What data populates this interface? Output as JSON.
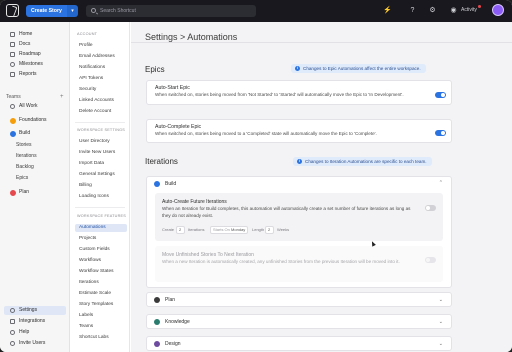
{
  "topbar": {
    "create_label": "Create Story",
    "search_placeholder": "Search Shortcut",
    "activity_label": "Activity"
  },
  "sidebar": {
    "items": [
      {
        "label": "Home",
        "icon": "home-icon"
      },
      {
        "label": "Docs",
        "icon": "docs-icon"
      },
      {
        "label": "Roadmap",
        "icon": "roadmap-icon"
      },
      {
        "label": "Milestones",
        "icon": "milestones-icon"
      },
      {
        "label": "Reports",
        "icon": "reports-icon"
      }
    ],
    "teams_label": "Teams",
    "all_work": "All Work",
    "foundations": "Foundations",
    "build": "Build",
    "build_sub": [
      "Stories",
      "Iterations",
      "Backlog",
      "Epics"
    ],
    "plan": "Plan",
    "bottom": [
      "Settings",
      "Integrations",
      "Help",
      "Invite Users"
    ]
  },
  "subnav": {
    "account_head": "ACCOUNT",
    "account_items": [
      "Profile",
      "Email Addresses",
      "Notifications",
      "API Tokens",
      "Security",
      "Linked Accounts",
      "Delete Account"
    ],
    "workspace_head": "WORKSPACE SETTINGS",
    "workspace_items": [
      "User Directory",
      "Invite New Users",
      "Import Data",
      "General Settings",
      "Billing",
      "Loading Icons"
    ],
    "features_head": "WORKSPACE FEATURES",
    "features_items": [
      "Automations",
      "Projects",
      "Custom Fields",
      "Workflows",
      "Workflow States",
      "Iterations",
      "Estimate Scale",
      "Story Templates",
      "Labels",
      "Teams",
      "Shortcut Labs"
    ]
  },
  "main": {
    "title": "Settings > Automations",
    "epics": {
      "title": "Epics",
      "info": "Changes to Epic Automations affect the entire workspace.",
      "cards": [
        {
          "title": "Auto-Start Epic",
          "desc": "When switched on, stories being moved from 'Not Started' to 'Started' will automatically move the Epic to 'In Development'.",
          "on": true
        },
        {
          "title": "Auto-Complete Epic",
          "desc": "When switched on, stories being moved to a 'Completed' state will automatically move the Epic to 'Complete'.",
          "on": true
        }
      ]
    },
    "iterations": {
      "title": "Iterations",
      "info": "Changes to Iteration Automations are specific to each team.",
      "build": {
        "name": "Build",
        "auto_create_title": "Auto-Create Future Iterations",
        "auto_create_desc": "When an Iteration for Build completes, this automation will automatically create a set number of future iterations as long as they do not already exist.",
        "create_label": "Create",
        "create_value": "2",
        "iterations_label": "Iterations",
        "starts_label": "Starts On",
        "starts_value": "Monday",
        "length_label": "Length",
        "length_value": "2",
        "weeks_label": "Weeks",
        "move_title": "Move Unfinished Stories To Next Iteration",
        "move_desc": "When a new Iteration is automatically created, any unfinished Stories from the previous Iteration will be moved into it."
      },
      "teams": [
        "Plan",
        "Knowledge",
        "Design"
      ]
    }
  }
}
